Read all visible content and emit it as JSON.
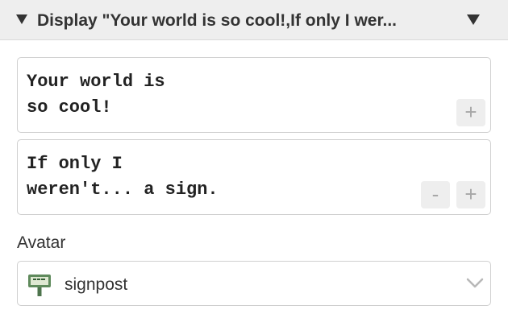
{
  "header": {
    "title": "Display \"Your world is so cool!,If only I wer..."
  },
  "messages": [
    {
      "text": "Your world is\nso cool!",
      "buttons": [
        "+"
      ]
    },
    {
      "text": "If only I\nweren't... a sign.",
      "buttons": [
        "-",
        "+"
      ]
    }
  ],
  "avatar": {
    "label": "Avatar",
    "value": "signpost",
    "icon": "signpost-icon"
  },
  "colors": {
    "header_bg": "#eeeeee",
    "border": "#cfcfcf",
    "button_bg": "#eeeeee",
    "button_fg": "#a7a7a7",
    "sign_green": "#5f8a5c"
  }
}
